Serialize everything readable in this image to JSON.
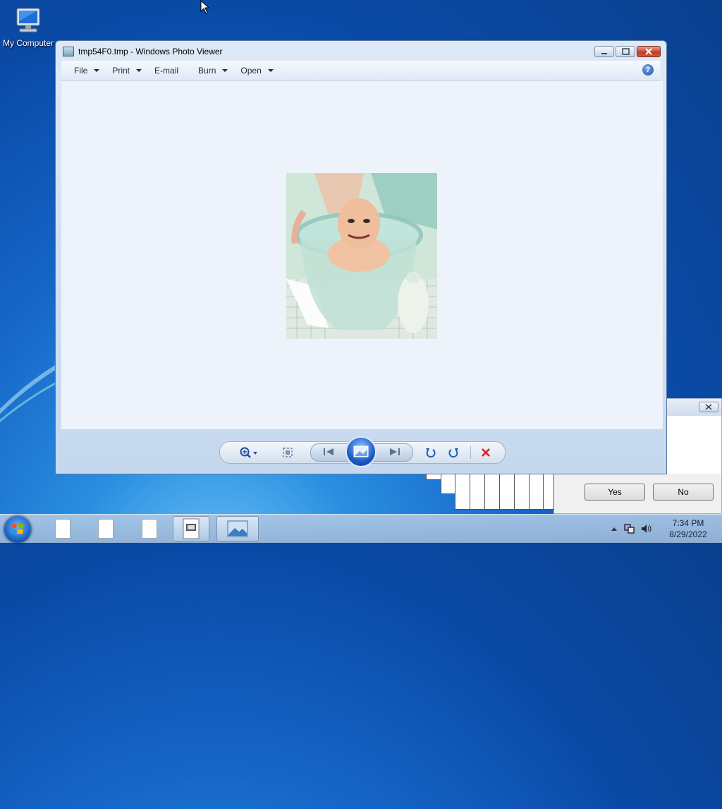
{
  "desktop": {
    "icons": [
      {
        "label": "My Computer",
        "icon": "computer-icon"
      }
    ]
  },
  "window": {
    "title": "tmp54F0.tmp - Windows Photo Viewer",
    "menu": [
      {
        "label": "File",
        "has_dropdown": true
      },
      {
        "label": "Print",
        "has_dropdown": true
      },
      {
        "label": "E-mail",
        "has_dropdown": false
      },
      {
        "label": "Burn",
        "has_dropdown": true
      },
      {
        "label": "Open",
        "has_dropdown": true
      }
    ],
    "help_label": "?",
    "controls": [
      "zoom-icon",
      "fit-window-icon",
      "previous-icon",
      "slideshow-icon",
      "next-icon",
      "rotate-counterclockwise-icon",
      "rotate-clockwise-icon",
      "delete-icon"
    ]
  },
  "dialog": {
    "buttons": {
      "yes": "Yes",
      "no": "No"
    }
  },
  "taskbar": {
    "time": "7:34 PM",
    "date": "8/29/2022",
    "tray_icons": [
      "show-hidden-icons-arrow",
      "network-icon",
      "volume-icon"
    ]
  },
  "colors": {
    "desktop_blue": "#1565c8",
    "window_frame": "#c5d8ee",
    "viewport": "#eef3fb",
    "close_red": "#c53a22",
    "delete_red": "#d8202a"
  }
}
